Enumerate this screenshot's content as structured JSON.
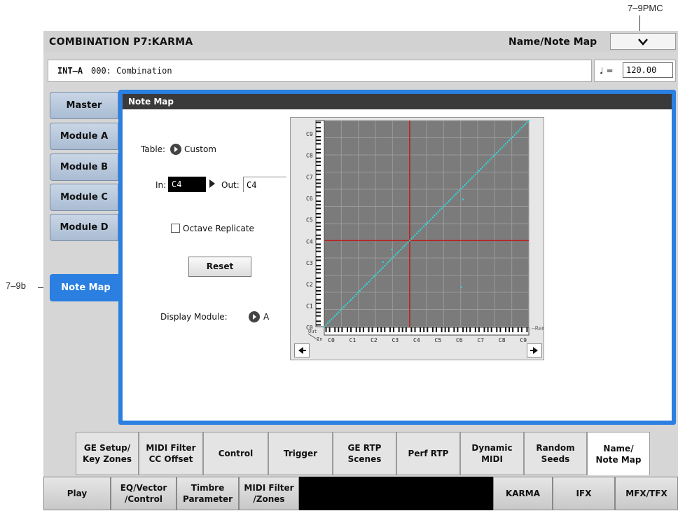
{
  "callouts": {
    "top": "7–9PMC",
    "left": "7–9b"
  },
  "title": {
    "mode": "COMBINATION P7:KARMA",
    "page": "Name/Note Map"
  },
  "program": {
    "bank": "INT–A",
    "name": "000: Combination"
  },
  "tempo": {
    "symbol": "♩ =",
    "value": "120.00"
  },
  "left_tabs": [
    "Master",
    "Module A",
    "Module B",
    "Module C",
    "Module D",
    "Note Map"
  ],
  "panel": {
    "title": "Note Map",
    "table_label": "Table:",
    "table_value": "Custom",
    "in_label": "In:",
    "in_value": "C4",
    "out_label": "Out:",
    "out_value": "C4",
    "octave_replicate_label": "Octave Replicate",
    "reset_label": "Reset",
    "display_module_label": "Display Module:",
    "display_module_value": "A"
  },
  "note_map": {
    "y_axis_labels": [
      "C9",
      "C8",
      "C7",
      "C6",
      "C5",
      "C4",
      "C3",
      "C2",
      "C1",
      "C0"
    ],
    "x_axis_labels": [
      "C0",
      "C1",
      "C2",
      "C3",
      "C4",
      "C5",
      "C6",
      "C7",
      "C8",
      "C9"
    ],
    "corner_out": "Out",
    "corner_in": "In",
    "remove_label": "Remove",
    "crosshair_note": "C4",
    "colors": {
      "background": "#7b7b7b",
      "grid": "#9a9a9a",
      "mapping": "#29e1e1",
      "crosshair": "#c01818"
    }
  },
  "bottom_tabs": [
    {
      "line1": "GE Setup/",
      "line2": "Key Zones"
    },
    {
      "line1": "MIDI Filter",
      "line2": "CC Offset"
    },
    {
      "line1": "Control",
      "line2": ""
    },
    {
      "line1": "Trigger",
      "line2": ""
    },
    {
      "line1": "GE RTP",
      "line2": "Scenes"
    },
    {
      "line1": "Perf RTP",
      "line2": ""
    },
    {
      "line1": "Dynamic",
      "line2": "MIDI"
    },
    {
      "line1": "Random",
      "line2": "Seeds"
    },
    {
      "line1": "Name/",
      "line2": "Note Map"
    }
  ],
  "page_buttons": [
    {
      "line1": "Play",
      "line2": ""
    },
    {
      "line1": "EQ/Vector",
      "line2": "/Control"
    },
    {
      "line1": "Timbre",
      "line2": "Parameter"
    },
    {
      "line1": "MIDI Filter",
      "line2": "/Zones"
    },
    {
      "line1": "KARMA",
      "line2": ""
    },
    {
      "line1": "IFX",
      "line2": ""
    },
    {
      "line1": "MFX/TFX",
      "line2": ""
    }
  ],
  "accent_color": "#2a7fe0"
}
